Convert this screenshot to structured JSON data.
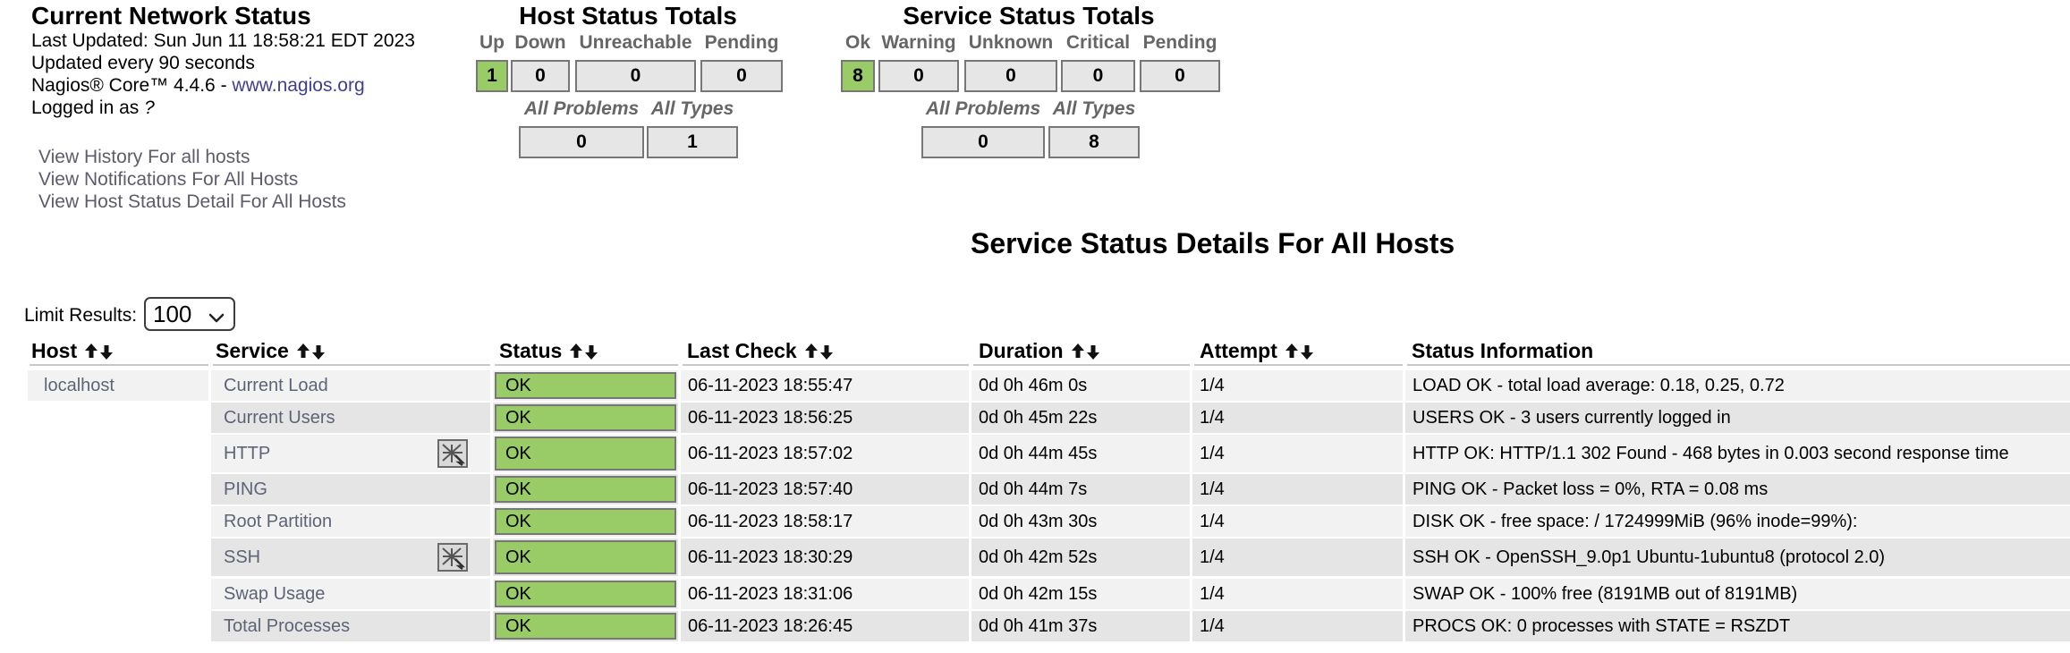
{
  "network_status": {
    "title": "Current Network Status",
    "last_updated": "Last Updated: Sun Jun 11 18:58:21 EDT 2023",
    "update_interval": "Updated every 90 seconds",
    "product_prefix": "Nagios® Core™ 4.4.6 - ",
    "product_link": "www.nagios.org",
    "logged_in_prefix": "Logged in as ",
    "logged_in_user": "?",
    "links": [
      "View History For all hosts",
      "View Notifications For All Hosts",
      "View Host Status Detail For All Hosts"
    ]
  },
  "host_totals": {
    "title": "Host Status Totals",
    "headers": [
      "Up",
      "Down",
      "Unreachable",
      "Pending"
    ],
    "values": [
      "1",
      "0",
      "0",
      "0"
    ],
    "summary_headers": [
      "All Problems",
      "All Types"
    ],
    "summary_values": [
      "0",
      "1"
    ]
  },
  "service_totals": {
    "title": "Service Status Totals",
    "headers": [
      "Ok",
      "Warning",
      "Unknown",
      "Critical",
      "Pending"
    ],
    "values": [
      "8",
      "0",
      "0",
      "0",
      "0"
    ],
    "summary_headers": [
      "All Problems",
      "All Types"
    ],
    "summary_values": [
      "0",
      "8"
    ]
  },
  "details": {
    "title": "Service Status Details For All Hosts",
    "limit_label": "Limit Results:",
    "limit_value": "100",
    "columns": [
      "Host",
      "Service",
      "Status",
      "Last Check",
      "Duration",
      "Attempt",
      "Status Information"
    ],
    "host": "localhost",
    "rows": [
      {
        "service": "Current Load",
        "status": "OK",
        "last_check": "06-11-2023 18:55:47",
        "duration": "0d 0h 46m 0s",
        "attempt": "1/4",
        "info": "LOAD OK - total load average: 0.18, 0.25, 0.72",
        "icon": false
      },
      {
        "service": "Current Users",
        "status": "OK",
        "last_check": "06-11-2023 18:56:25",
        "duration": "0d 0h 45m 22s",
        "attempt": "1/4",
        "info": "USERS OK - 3 users currently logged in",
        "icon": false
      },
      {
        "service": "HTTP",
        "status": "OK",
        "last_check": "06-11-2023 18:57:02",
        "duration": "0d 0h 44m 45s",
        "attempt": "1/4",
        "info": "HTTP OK: HTTP/1.1 302 Found - 468 bytes in 0.003 second response time",
        "icon": true
      },
      {
        "service": "PING",
        "status": "OK",
        "last_check": "06-11-2023 18:57:40",
        "duration": "0d 0h 44m 7s",
        "attempt": "1/4",
        "info": "PING OK - Packet loss = 0%, RTA = 0.08 ms",
        "icon": false
      },
      {
        "service": "Root Partition",
        "status": "OK",
        "last_check": "06-11-2023 18:58:17",
        "duration": "0d 0h 43m 30s",
        "attempt": "1/4",
        "info": "DISK OK - free space: / 1724999MiB (96% inode=99%):",
        "icon": false
      },
      {
        "service": "SSH",
        "status": "OK",
        "last_check": "06-11-2023 18:30:29",
        "duration": "0d 0h 42m 52s",
        "attempt": "1/4",
        "info": "SSH OK - OpenSSH_9.0p1 Ubuntu-1ubuntu8 (protocol 2.0)",
        "icon": true
      },
      {
        "service": "Swap Usage",
        "status": "OK",
        "last_check": "06-11-2023 18:31:06",
        "duration": "0d 0h 42m 15s",
        "attempt": "1/4",
        "info": "SWAP OK - 100% free (8191MB out of 8191MB)",
        "icon": false
      },
      {
        "service": "Total Processes",
        "status": "OK",
        "last_check": "06-11-2023 18:26:45",
        "duration": "0d 0h 41m 37s",
        "attempt": "1/4",
        "info": "PROCS OK: 0 processes with STATE = RSZDT",
        "icon": false
      }
    ]
  },
  "icons": {
    "sort": [
      "sort-ascending-icon",
      "sort-descending-icon"
    ],
    "service_action": "service-link-icon",
    "dropdown": "chevron-down-icon"
  },
  "colors": {
    "ok": "#99cc66",
    "box": "#e6e6e6",
    "row_even": "#f2f2f2",
    "row_odd": "#e5e5e5"
  }
}
